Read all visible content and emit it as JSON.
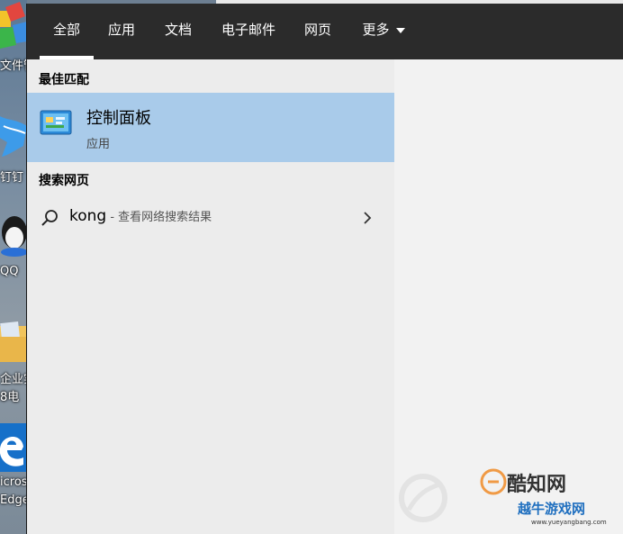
{
  "desktop": {
    "labels": [
      "文件管",
      "钉钉",
      "QQ",
      "企业实",
      "8电",
      "icros",
      "Edge"
    ]
  },
  "search_panel": {
    "tabs": [
      {
        "label": "全部",
        "active": true
      },
      {
        "label": "应用",
        "active": false
      },
      {
        "label": "文档",
        "active": false
      },
      {
        "label": "电子邮件",
        "active": false
      },
      {
        "label": "网页",
        "active": false
      },
      {
        "label": "更多",
        "active": false,
        "has_dropdown": true
      }
    ],
    "best_match": {
      "heading": "最佳匹配",
      "name": "控制面板",
      "type": "应用",
      "icon": "control-panel-icon"
    },
    "web_search": {
      "heading": "搜索网页",
      "query": "kong",
      "suffix": " - 查看网络搜索结果",
      "icon": "search-icon"
    }
  },
  "watermark": {
    "title": "酷知网",
    "subtitle": "越牛游戏网",
    "url": "www.yueyangbang.com"
  },
  "colors": {
    "topbar": "#2b2b2b",
    "panel": "#ececec",
    "highlight": "#a9cbea",
    "preview": "#f2f2f2"
  }
}
